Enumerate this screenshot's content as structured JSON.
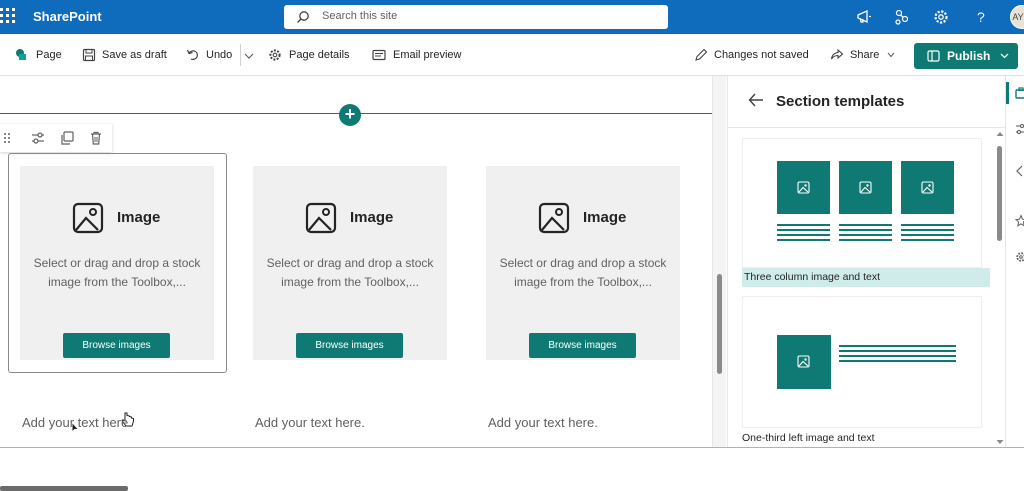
{
  "suite": {
    "brand": "SharePoint",
    "search_placeholder": "Search this site",
    "avatar_initials": "AY"
  },
  "command_bar": {
    "page": "Page",
    "save_as_draft": "Save as draft",
    "undo": "Undo",
    "page_details": "Page details",
    "email_preview": "Email preview",
    "changes_status": "Changes not saved",
    "share": "Share",
    "publish": "Publish"
  },
  "canvas": {
    "webparts": [
      {
        "title": "Image",
        "description": "Select or drag and drop a stock image from the Toolbox,...",
        "button": "Browse images",
        "text_placeholder": "Add your text here."
      },
      {
        "title": "Image",
        "description": "Select or drag and drop a stock image from the Toolbox,...",
        "button": "Browse images",
        "text_placeholder": "Add your text here."
      },
      {
        "title": "Image",
        "description": "Select or drag and drop a stock image from the Toolbox,...",
        "button": "Browse images",
        "text_placeholder": "Add your text here."
      }
    ]
  },
  "pane": {
    "title": "Section templates",
    "templates": [
      {
        "label": "Three column image and text",
        "selected": true
      },
      {
        "label": "One-third left image and text",
        "selected": false
      }
    ]
  },
  "colors": {
    "suite_blue": "#0f6cbd",
    "accent_teal": "#0f7a73",
    "selected_template_bg": "#cfecea"
  }
}
